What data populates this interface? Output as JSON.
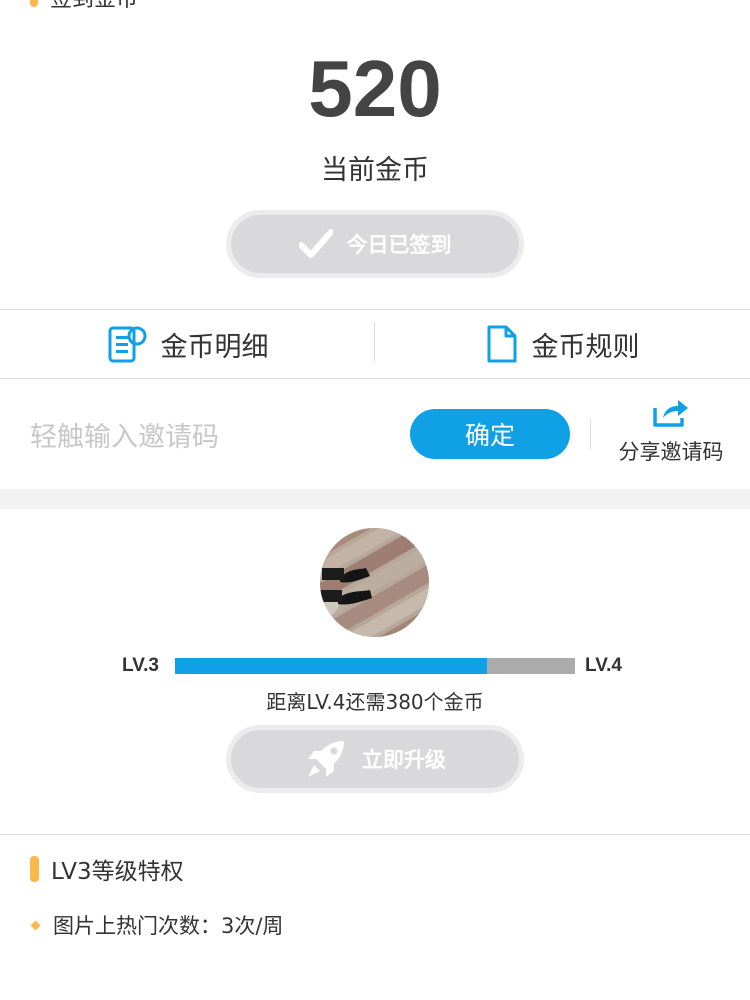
{
  "section": {
    "title": "签到金币"
  },
  "coins": {
    "amount": "520",
    "label": "当前金币"
  },
  "checkin": {
    "label": "今日已签到",
    "icon": "check-icon"
  },
  "links": [
    {
      "label": "金币明细",
      "icon": "coin-detail-icon"
    },
    {
      "label": "金币规则",
      "icon": "document-icon"
    }
  ],
  "invite": {
    "placeholder": "轻触输入邀请码",
    "confirm_label": "确定",
    "share_label": "分享邀请码",
    "share_icon": "share-icon"
  },
  "level": {
    "current": "LV.3",
    "next": "LV.4",
    "progress": 0.78,
    "distance_text": "距离LV.4还需380个金币",
    "upgrade_label": "立即升级",
    "upgrade_icon": "rocket-icon"
  },
  "privilege": {
    "title": "LV3等级特权",
    "items": [
      "图片上热门次数：3次/周"
    ]
  },
  "colors": {
    "accent": "#0fa0e6",
    "highlight": "#f8b84a",
    "disabled_button": "#d9d9dc"
  }
}
